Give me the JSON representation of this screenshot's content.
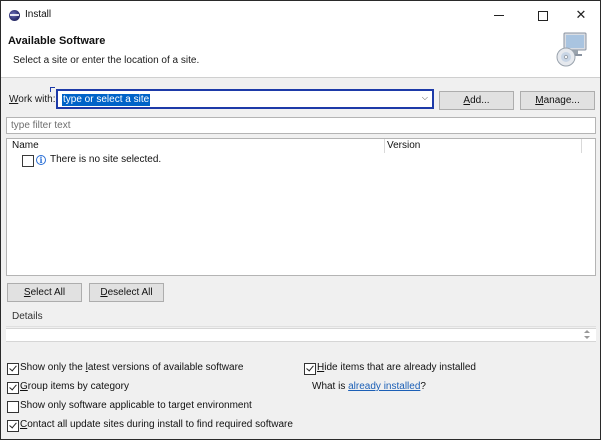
{
  "window": {
    "title": "Install",
    "minimize_glyph": "",
    "close_glyph": "✕"
  },
  "header": {
    "title": "Available Software",
    "description": "Select a site or enter the location of a site."
  },
  "work_with": {
    "label_prefix": "W",
    "label_rest": "ork with:",
    "value": "type or select a site",
    "dropdown_glyph": "⌵",
    "add_label_prefix": "A",
    "add_label_rest": "dd...",
    "manage_label_prefix": "M",
    "manage_label_rest": "anage..."
  },
  "filter": {
    "placeholder": "type filter text"
  },
  "table": {
    "columns": [
      "Name",
      "Version"
    ],
    "empty_message": "There is no site selected."
  },
  "selection_buttons": {
    "select_all_prefix": "S",
    "select_all_rest": "elect All",
    "deselect_all_prefix": "D",
    "deselect_all_rest": "eselect All"
  },
  "details": {
    "label": "Details"
  },
  "options": {
    "show_latest": {
      "checked": true,
      "before": "Show only the ",
      "mnemonic": "l",
      "after": "atest versions of available software"
    },
    "group_by_category": {
      "checked": true,
      "mnemonic": "G",
      "after": "roup items by category"
    },
    "target_env": {
      "checked": false,
      "text": "Show only software applicable to target environment"
    },
    "contact_sites": {
      "checked": true,
      "mnemonic": "C",
      "after": "ontact all update sites during install to find required software"
    },
    "hide_installed": {
      "checked": true,
      "mnemonic": "H",
      "after": "ide items that are already installed"
    },
    "what_is": {
      "prefix": "What is ",
      "link": "already installed",
      "suffix": "?"
    }
  }
}
